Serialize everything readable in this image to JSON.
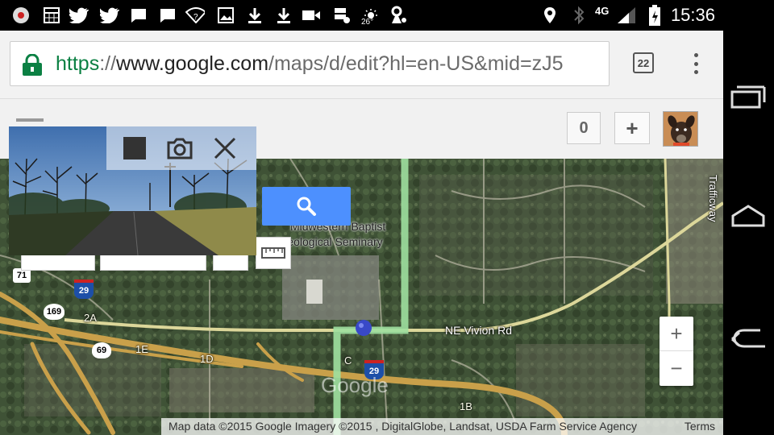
{
  "status_bar": {
    "time": "15:36",
    "network": "4G",
    "weather_temp": "26°",
    "left_icons": [
      "record-icon",
      "calculator-icon",
      "twitter-icon",
      "twitter-icon",
      "chat-icon",
      "chat-icon",
      "wifi-question-icon",
      "image-icon",
      "download-icon",
      "download-icon",
      "video-icon",
      "sd-card-icon",
      "weather-icon",
      "reminder-icon"
    ],
    "right_icons": [
      "location-icon",
      "bluetooth-icon",
      "signal-icon",
      "battery-charging-icon"
    ]
  },
  "browser": {
    "url_scheme": "https",
    "url_sep": "://",
    "url_domain": "www.google.com",
    "url_path": "/maps/d/edit?hl=en-US&mid=zJ5",
    "tab_count": "22"
  },
  "maps_header": {
    "count": "0",
    "add_label": "+"
  },
  "map": {
    "labels": {
      "seminary_line1": "Midwestern Baptist",
      "seminary_line2": "Theological Seminary",
      "road_vivion": "NE Vivion Rd",
      "trafficway": "Trafficway",
      "exit_2a": "2A",
      "exit_1e": "1E",
      "exit_1d": "1D",
      "exit_c": "C",
      "exit_1b": "1B",
      "shield_71": "71",
      "shield_29a": "29",
      "shield_169": "169",
      "shield_69": "69",
      "shield_29b": "29",
      "watermark": "Google"
    },
    "attribution": "Map data ©2015 Google Imagery ©2015 , DigitalGlobe, Landsat, USDA Farm Service Agency",
    "terms": "Terms",
    "zoom_in": "+",
    "zoom_out": "−"
  },
  "colors": {
    "route": "#9fe0a0",
    "highway": "#c9a04a",
    "search_blue": "#4d90fe",
    "url_green": "#0b8043"
  }
}
